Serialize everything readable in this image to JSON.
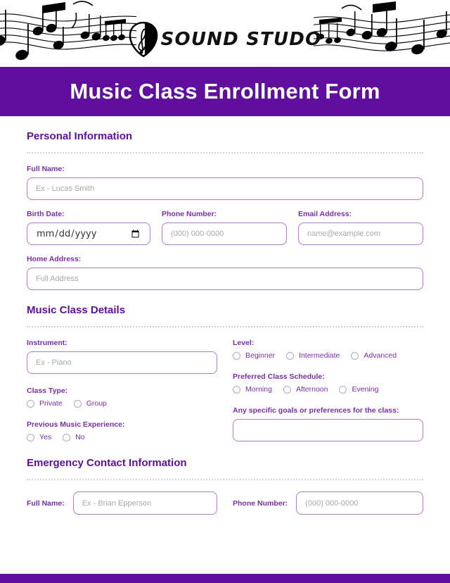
{
  "brand": {
    "logo_text": "SOUND STUDO",
    "logo_icon": "guitar-pick-treble-clef-icon",
    "decoration": "music-staff-notes"
  },
  "banner": {
    "title": "Music Class Enrollment Form",
    "background_color": "#5F0E9E",
    "text_color": "#FFFFFF"
  },
  "theme": {
    "purple": "#5F0E9E",
    "label_purple": "#7A2EA8",
    "input_border": "#B07CC6",
    "divider": "#D9D0E8",
    "placeholder": "#A9A9A9"
  },
  "sections": {
    "personal": {
      "title": "Personal Information",
      "full_name": {
        "label": "Full Name:",
        "placeholder": "Ex - Lucas Smith",
        "value": ""
      },
      "birth_date": {
        "label": "Birth Date:",
        "placeholder": "mm/dd/yyyy",
        "value": ""
      },
      "phone": {
        "label": "Phone Number:",
        "placeholder": "(000) 000-0000",
        "value": ""
      },
      "email": {
        "label": "Email Address:",
        "placeholder": "name@example.com",
        "value": ""
      },
      "home_address": {
        "label": "Home Address:",
        "placeholder": "Full Address",
        "value": ""
      }
    },
    "class_details": {
      "title": "Music Class Details",
      "instrument": {
        "label": "Instrument:",
        "placeholder": "Ex - Piano",
        "value": ""
      },
      "level": {
        "label": "Level:",
        "options": [
          "Beginner",
          "Intermediate",
          "Advanced"
        ],
        "selected": ""
      },
      "class_type": {
        "label": "Class Type:",
        "options": [
          "Private",
          "Group"
        ],
        "selected": ""
      },
      "schedule": {
        "label": "Preferred Class Schedule:",
        "options": [
          "Morning",
          "Afternoon",
          "Evening"
        ],
        "selected": ""
      },
      "experience": {
        "label": "Previous Music Experience:",
        "options": [
          "Yes",
          "No"
        ],
        "selected": ""
      },
      "goals": {
        "label": "Any specific goals or preferences for the class:",
        "placeholder": "",
        "value": ""
      }
    },
    "emergency": {
      "title": "Emergency Contact Information",
      "full_name": {
        "label": "Full Name:",
        "placeholder": "Ex - Brian Epperson",
        "value": ""
      },
      "phone": {
        "label": "Phone Number:",
        "placeholder": "(000) 000-0000",
        "value": ""
      }
    }
  }
}
